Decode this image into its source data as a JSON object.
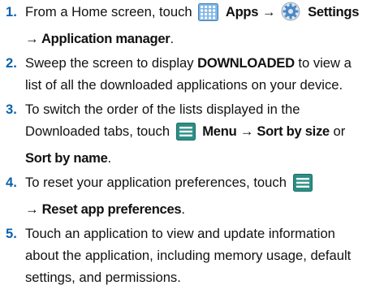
{
  "steps": [
    {
      "num": "1.",
      "t1": "From a Home screen, touch ",
      "apps": "Apps",
      "arrow1": " → ",
      "settings": "Settings",
      "arrow2": "→ ",
      "app_manager": "Application manager",
      "end": "."
    },
    {
      "num": "2.",
      "t1": "Sweep the screen to display ",
      "downloaded": "DOWNLOADED",
      "t2": " to view a",
      "t3": "list of all the downloaded applications on your device."
    },
    {
      "num": "3.",
      "t1": "To switch the order of the lists displayed in the",
      "t2": "Downloaded tabs, touch ",
      "menu": "Menu",
      "arrow": " → ",
      "sort_size": "Sort by size",
      "or": " or",
      "sort_name": "Sort by name",
      "end": "."
    },
    {
      "num": "4.",
      "t1": "To reset your application preferences, touch ",
      "arrow": "→ ",
      "reset": "Reset app preferences",
      "end": "."
    },
    {
      "num": "5.",
      "t1": "Touch an application to view and update information",
      "t2": "about the application, including memory usage, default",
      "t3": "settings, and permissions."
    }
  ],
  "icons": {
    "apps": "apps-grid-icon",
    "settings": "settings-gear-icon",
    "menu": "menu-icon"
  },
  "colors": {
    "step_number": "#0c62ad",
    "apps_icon": "#4a8fd1",
    "menu_icon": "#2d8f86"
  }
}
